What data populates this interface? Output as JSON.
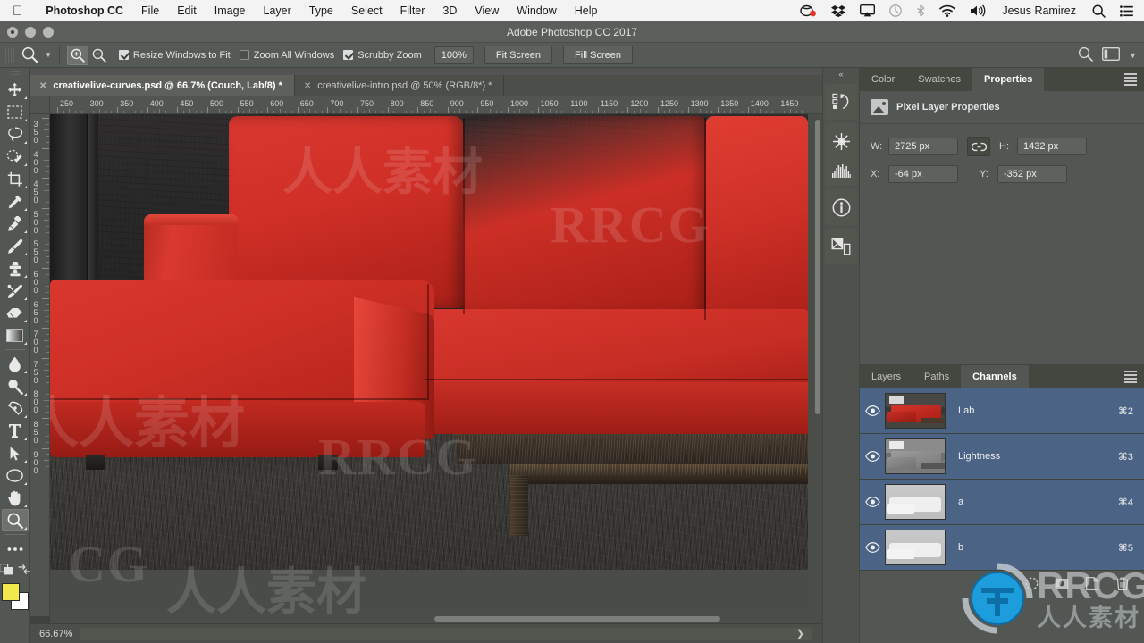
{
  "macbar": {
    "apple_icon": "apple-logo-icon",
    "items": [
      "Photoshop CC",
      "File",
      "Edit",
      "Image",
      "Layer",
      "Type",
      "Select",
      "Filter",
      "3D",
      "View",
      "Window",
      "Help"
    ],
    "status_icons": [
      "screen-recording-icon",
      "dropbox-icon",
      "airplay-icon",
      "time-machine-icon",
      "bluetooth-icon",
      "wifi-icon",
      "volume-icon"
    ],
    "username": "Jesus Ramirez",
    "search_icon": "spotlight-search-icon",
    "notification_icon": "notification-center-icon"
  },
  "window": {
    "title": "Adobe Photoshop CC 2017",
    "close": "close-button",
    "minimize": "minimize-button",
    "maximize": "maximize-button"
  },
  "options_bar": {
    "tool_icon": "zoom-tool-icon",
    "preset_chevron": "chevron-down-icon",
    "zoom_in_icon": "zoom-in-icon",
    "zoom_out_icon": "zoom-out-icon",
    "checkboxes": [
      {
        "label": "Resize Windows to Fit",
        "checked": true
      },
      {
        "label": "Zoom All Windows",
        "checked": false
      },
      {
        "label": "Scrubby Zoom",
        "checked": true
      }
    ],
    "zoom_value": "100%",
    "buttons": [
      "Fit Screen",
      "Fill Screen"
    ],
    "right_icons": [
      "search-icon",
      "workspace-switcher-icon",
      "chevron-down-icon"
    ]
  },
  "toolbar": {
    "tools": [
      {
        "name": "move-tool",
        "active": false
      },
      {
        "name": "rectangular-marquee-tool",
        "active": false
      },
      {
        "name": "lasso-tool",
        "active": false
      },
      {
        "name": "quick-selection-tool",
        "active": false
      },
      {
        "name": "crop-tool",
        "active": false
      },
      {
        "name": "eyedropper-tool",
        "active": false
      },
      {
        "name": "spot-healing-brush-tool",
        "active": false
      },
      {
        "name": "brush-tool",
        "active": false
      },
      {
        "name": "clone-stamp-tool",
        "active": false
      },
      {
        "name": "history-brush-tool",
        "active": false
      },
      {
        "name": "eraser-tool",
        "active": false
      },
      {
        "name": "gradient-tool",
        "active": false
      },
      {
        "name": "blur-tool",
        "active": false
      },
      {
        "name": "dodge-tool",
        "active": false
      },
      {
        "name": "pen-tool",
        "active": false
      },
      {
        "name": "type-tool",
        "active": false
      },
      {
        "name": "path-selection-tool",
        "active": false
      },
      {
        "name": "ellipse-shape-tool",
        "active": false
      },
      {
        "name": "hand-tool",
        "active": false
      },
      {
        "name": "zoom-tool",
        "active": true
      },
      {
        "name": "edit-toolbar-tool",
        "active": false
      }
    ],
    "quick_mask_icon": "quick-mask-icon",
    "screen_mode_icon": "screen-mode-icon",
    "foreground_color": "#f2ea4c",
    "background_color": "#ffffff"
  },
  "document_tabs": [
    {
      "label": "creativelive-curves.psd @ 66.7% (Couch, Lab/8) *",
      "active": true,
      "close_icon": "close-tab-icon"
    },
    {
      "label": "creativelive-intro.psd @ 50% (RGB/8*) *",
      "active": false,
      "close_icon": "close-tab-icon"
    }
  ],
  "rulers": {
    "unit": "px",
    "horizontal_labels": [
      "250",
      "300",
      "350",
      "400",
      "450",
      "500",
      "550",
      "600",
      "650",
      "700",
      "750",
      "800",
      "850",
      "900",
      "950",
      "1000",
      "1050",
      "1100",
      "1150",
      "1200",
      "1250",
      "1300",
      "1350",
      "1400",
      "1450"
    ],
    "vertical_labels": [
      "350",
      "400",
      "450",
      "500",
      "550",
      "600",
      "650",
      "700",
      "750",
      "800",
      "850",
      "900"
    ]
  },
  "canvas": {
    "cursor_icon": "zoom-in-cursor",
    "watermarks": [
      "人人素材",
      "RRCG"
    ]
  },
  "status_bar": {
    "zoom": "66.67%",
    "expand_icon": "chevron-right-icon"
  },
  "icon_dock": {
    "collapse_icon": "collapse-panels-icon",
    "icons": [
      "history-icon",
      "adjustments-icon",
      "histogram-icon",
      "info-icon",
      "layer-comps-icon"
    ]
  },
  "properties_panel": {
    "tabs": [
      {
        "label": "Color",
        "active": false
      },
      {
        "label": "Swatches",
        "active": false
      },
      {
        "label": "Properties",
        "active": true
      }
    ],
    "menu_icon": "panel-menu-icon",
    "header_icon": "pixel-layer-icon",
    "header": "Pixel Layer Properties",
    "fields": {
      "w_label": "W:",
      "w_value": "2725 px",
      "h_label": "H:",
      "h_value": "1432 px",
      "x_label": "X:",
      "x_value": "-64 px",
      "y_label": "Y:",
      "y_value": "-352 px",
      "link_icon": "link-chain-icon"
    }
  },
  "channels_panel": {
    "tabs": [
      {
        "label": "Layers",
        "active": false
      },
      {
        "label": "Paths",
        "active": false
      },
      {
        "label": "Channels",
        "active": true
      }
    ],
    "menu_icon": "panel-menu-icon",
    "selected_color": "#4b6384",
    "rows": [
      {
        "name": "Lab",
        "shortcut": "⌘2",
        "visible": true,
        "thumb": "composite",
        "selected": true
      },
      {
        "name": "Lightness",
        "shortcut": "⌘3",
        "visible": true,
        "thumb": "grayscale",
        "selected": true
      },
      {
        "name": "a",
        "shortcut": "⌘4",
        "visible": true,
        "thumb": "flat",
        "selected": true
      },
      {
        "name": "b",
        "shortcut": "⌘5",
        "visible": true,
        "thumb": "flat",
        "selected": true
      }
    ],
    "footer_icons": [
      "load-channel-as-selection-icon",
      "save-selection-as-channel-icon",
      "new-channel-icon",
      "delete-channel-icon"
    ]
  },
  "overlay_watermark": {
    "text": "RRCG",
    "subtext": "人人素材",
    "logo_icon": "rrcg-logo-icon"
  }
}
